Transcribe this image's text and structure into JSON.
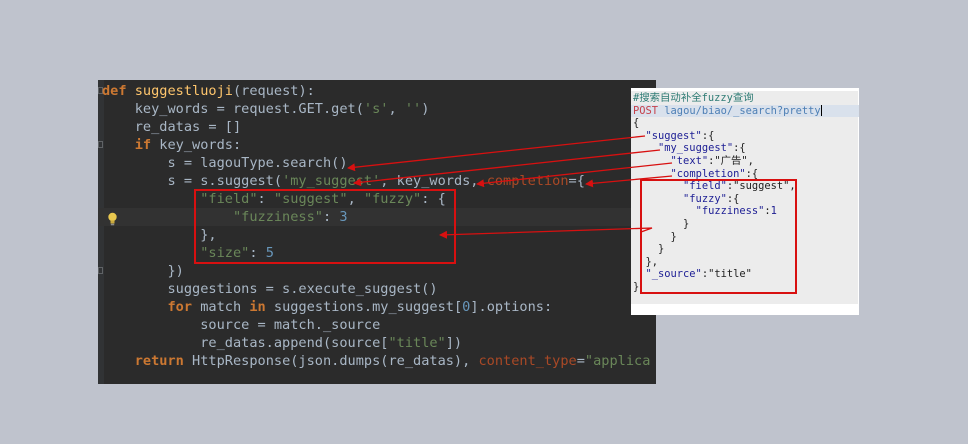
{
  "editor": {
    "lines": [
      [
        [
          "kw",
          "def "
        ],
        [
          "fn",
          "suggestluoji"
        ],
        [
          "t",
          "(request):"
        ]
      ],
      [
        [
          "t",
          "    key_words = request.GET.get("
        ],
        [
          "st",
          "'s'"
        ],
        [
          "t",
          ", "
        ],
        [
          "st",
          "''"
        ],
        [
          "t",
          ")"
        ]
      ],
      [
        [
          "t",
          "    re_datas = []"
        ]
      ],
      [
        [
          "t",
          "    "
        ],
        [
          "kw",
          "if"
        ],
        [
          "t",
          " key_words:"
        ]
      ],
      [
        [
          "t",
          "        s = lagouType.search()"
        ]
      ],
      [
        [
          "t",
          "        s = s.suggest("
        ],
        [
          "st",
          "'my_suggest'"
        ],
        [
          "t",
          ", key_words, "
        ],
        [
          "kv",
          "completion"
        ],
        [
          "t",
          "={"
        ]
      ],
      [
        [
          "t",
          "            "
        ],
        [
          "st",
          "\"field\""
        ],
        [
          "t",
          ": "
        ],
        [
          "st",
          "\"suggest\""
        ],
        [
          "t",
          ", "
        ],
        [
          "st",
          "\"fuzzy\""
        ],
        [
          "t",
          ": {"
        ]
      ],
      [
        [
          "t",
          "                "
        ],
        [
          "st",
          "\"fuzziness\""
        ],
        [
          "t",
          ": "
        ],
        [
          "nm",
          "3"
        ]
      ],
      [
        [
          "t",
          "            },"
        ]
      ],
      [
        [
          "t",
          "            "
        ],
        [
          "st",
          "\"size\""
        ],
        [
          "t",
          ": "
        ],
        [
          "nm",
          "5"
        ]
      ],
      [
        [
          "t",
          "        })"
        ]
      ],
      [
        [
          "t",
          "        suggestions = s.execute_suggest()"
        ]
      ],
      [
        [
          "t",
          "        "
        ],
        [
          "kw",
          "for"
        ],
        [
          "t",
          " match "
        ],
        [
          "kw",
          "in"
        ],
        [
          "t",
          " suggestions.my_suggest["
        ],
        [
          "nm",
          "0"
        ],
        [
          "t",
          "].options:"
        ]
      ],
      [
        [
          "t",
          "            source = match._source"
        ]
      ],
      [
        [
          "t",
          "            re_datas.append(source["
        ],
        [
          "st",
          "\"title\""
        ],
        [
          "t",
          "])"
        ]
      ],
      [
        [
          "t",
          "    "
        ],
        [
          "kw",
          "return"
        ],
        [
          "t",
          " HttpResponse(json.dumps(re_datas), "
        ],
        [
          "kv",
          "content_type"
        ],
        [
          "t",
          "="
        ],
        [
          "st",
          "\"applica"
        ]
      ]
    ],
    "highlight_line": 7,
    "fold_lines": [
      0,
      3,
      10
    ]
  },
  "kibana": {
    "lines": [
      [
        [
          "kc",
          "#搜索自动补全fuzzy查询"
        ]
      ],
      [
        [
          "kpost",
          "POST"
        ],
        [
          "t",
          " "
        ],
        [
          "kpath",
          "lagou/biao/_search?pretty"
        ]
      ],
      [
        [
          "t",
          "{"
        ]
      ],
      [
        [
          "t",
          "  "
        ],
        [
          "kk",
          "\"suggest\""
        ],
        [
          "t",
          ":{"
        ]
      ],
      [
        [
          "t",
          "    "
        ],
        [
          "kk",
          "\"my_suggest\""
        ],
        [
          "t",
          ":{"
        ]
      ],
      [
        [
          "t",
          "      "
        ],
        [
          "kk",
          "\"text\""
        ],
        [
          "t",
          ":"
        ],
        [
          "kstr",
          "\"广告\""
        ],
        [
          "t",
          ","
        ]
      ],
      [
        [
          "t",
          "      "
        ],
        [
          "kk",
          "\"completion\""
        ],
        [
          "t",
          ":{"
        ]
      ],
      [
        [
          "t",
          "        "
        ],
        [
          "kk",
          "\"field\""
        ],
        [
          "t",
          ":"
        ],
        [
          "kstr",
          "\"suggest\""
        ],
        [
          "t",
          ","
        ]
      ],
      [
        [
          "t",
          "        "
        ],
        [
          "kk",
          "\"fuzzy\""
        ],
        [
          "t",
          ":{"
        ]
      ],
      [
        [
          "t",
          "          "
        ],
        [
          "kk",
          "\"fuzziness\""
        ],
        [
          "t",
          ":"
        ],
        [
          "knum",
          "1"
        ]
      ],
      [
        [
          "t",
          "        }"
        ]
      ],
      [
        [
          "t",
          "      }"
        ]
      ],
      [
        [
          "t",
          "    }"
        ]
      ],
      [
        [
          "t",
          "  },"
        ]
      ],
      [
        [
          "t",
          "  "
        ],
        [
          "kk",
          "\"_source\""
        ],
        [
          "t",
          ":"
        ],
        [
          "kstr",
          "\"title\""
        ]
      ],
      [
        [
          "t",
          "}"
        ]
      ]
    ],
    "highlight_line": 1
  }
}
